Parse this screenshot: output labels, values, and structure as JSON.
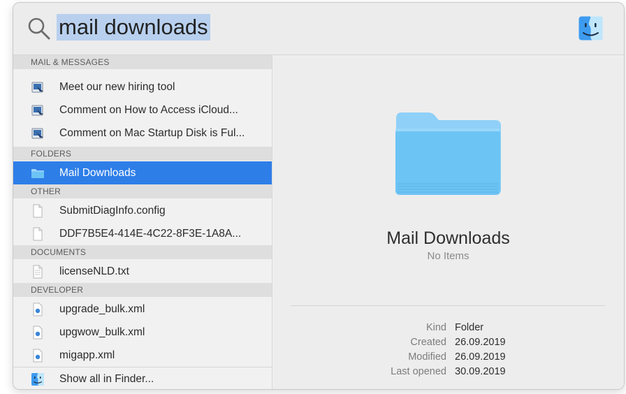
{
  "search": {
    "query": "mail downloads"
  },
  "results": {
    "sections": {
      "mail": "MAIL & MESSAGES",
      "folders": "FOLDERS",
      "other": "OTHER",
      "documents": "DOCUMENTS",
      "developer": "DEVELOPER"
    },
    "mail_items": [
      "Meet our new hiring tool",
      "Comment on How to Access iCloud...",
      "Comment on Mac Startup Disk is Ful..."
    ],
    "folder_items": [
      "Mail Downloads"
    ],
    "other_items": [
      "SubmitDiagInfo.config",
      "DDF7B5E4-414E-4C22-8F3E-1A8A..."
    ],
    "document_items": [
      "licenseNLD.txt"
    ],
    "developer_items": [
      "upgrade_bulk.xml",
      "upgwow_bulk.xml",
      "migapp.xml"
    ],
    "show_all": "Show all in Finder..."
  },
  "preview": {
    "title": "Mail Downloads",
    "subtitle": "No Items",
    "meta": [
      {
        "key": "Kind",
        "value": "Folder"
      },
      {
        "key": "Created",
        "value": "26.09.2019"
      },
      {
        "key": "Modified",
        "value": "26.09.2019"
      },
      {
        "key": "Last opened",
        "value": "30.09.2019"
      }
    ]
  },
  "colors": {
    "selection": "#2e7ee8",
    "query_highlight": "#b8d0ee",
    "folder_blue": "#6cc4f5"
  },
  "icons": {
    "search": "magnifier-icon",
    "finder": "finder-icon",
    "mail": "mail-message-icon",
    "folder": "folder-icon",
    "file": "document-icon",
    "xml": "xml-file-icon"
  }
}
